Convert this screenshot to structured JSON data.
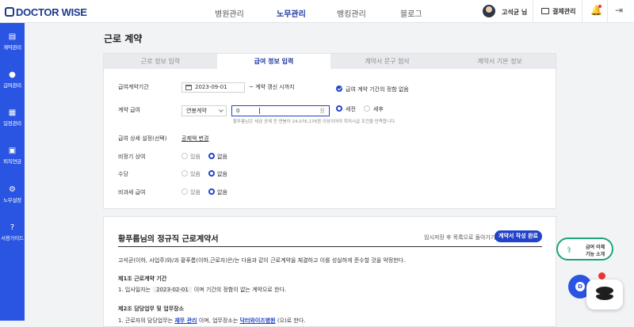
{
  "app": {
    "logo": "DOCTOR WISE",
    "nav": [
      "병원관리",
      "노무관리",
      "뱅킹관리",
      "블로그"
    ],
    "active_nav": "노무관리",
    "user_name": "고석균 님",
    "settlement": "결제관리"
  },
  "sidebar": {
    "items": [
      {
        "label": "계약관리",
        "icon": "contract-icon"
      },
      {
        "label": "급여관리",
        "icon": "salary-icon"
      },
      {
        "label": "일정관리",
        "icon": "calendar-icon"
      },
      {
        "label": "퇴직연금",
        "icon": "pension-icon"
      },
      {
        "label": "노무설정",
        "icon": "gear-icon"
      },
      {
        "label": "사용가이드",
        "icon": "help-icon"
      }
    ]
  },
  "page": {
    "title": "근로 계약"
  },
  "tabs": [
    "근로 정보 입력",
    "급여 정보 입력",
    "계약서 문구 첨삭",
    "계약서 기본 정보"
  ],
  "active_tab": "급여 정보 입력",
  "form": {
    "period_label": "급여계약기간",
    "start_date": "2023-09-01",
    "until_renewal": "~ 계약 갱신 시까지",
    "no_end_label": "급여 계약 기간의 정함 없음",
    "wage_label": "계약 급여",
    "wage_type": "연봉계약",
    "wage_value": "0",
    "wage_unit": "원",
    "before_tax": "세전",
    "after_tax": "세후",
    "hint": "황푸름님은 세금 공제 전 연봉이 24,076,176원 이상이어야 최저시급 조건을 만족합니다.",
    "detail_label": "급여 상세 설정(선택)",
    "detail_link": "공제액 변경",
    "rows": [
      {
        "label": "비정기 상여",
        "yes": "있음",
        "no": "없음"
      },
      {
        "label": "수당",
        "yes": "있음",
        "no": "없음"
      },
      {
        "label": "비과세 급여",
        "yes": "있음",
        "no": "없음"
      }
    ]
  },
  "contract": {
    "title": "황푸름님의 정규직 근로계약서",
    "save_text": "임시저장 후 목록으로 돌아가기",
    "complete_button": "계약서 작성 완료",
    "intro": "고석균(이하, 사업주)와/과 황푸름(이하,근로자)은/는 다음과 같이 근로계약을 체결하고 이를 성실하게 준수할 것을 약정한다.",
    "art1_title": "제1조 근로계약 기간",
    "art1_prefix": "1. 입사일자는",
    "art1_date": "2023-02-01",
    "art1_suffix": "이며 기간의 정함이 없는 계약으로 한다.",
    "art2_title": "제2조 담당업무 및 업무장소",
    "art2_prefix": "1. 근로자의 담당업무는",
    "art2_job": "재무 관리",
    "art2_mid": "이며, 업무장소는",
    "art2_place": "닥터와이즈병원",
    "art2_suffix": "(으)로 한다."
  },
  "floating": {
    "intro_line1": "급여 이체",
    "intro_line2": "기능 소개",
    "chat_letter": "D"
  }
}
